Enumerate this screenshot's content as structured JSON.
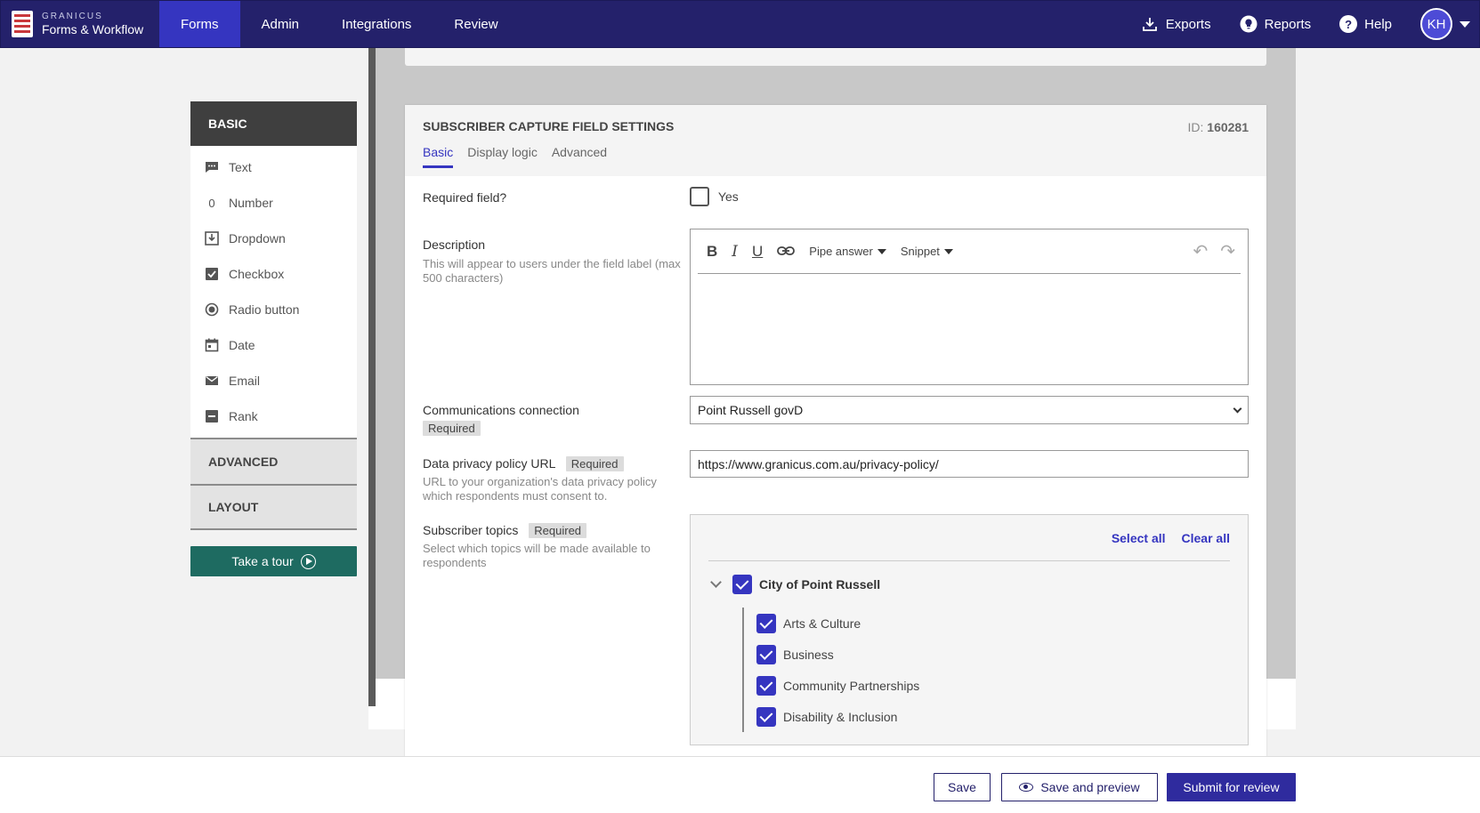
{
  "app": {
    "brand_top": "GRANICUS",
    "brand_bottom": "Forms & Workflow"
  },
  "nav": {
    "items": [
      {
        "label": "Forms"
      },
      {
        "label": "Admin"
      },
      {
        "label": "Integrations"
      },
      {
        "label": "Review"
      }
    ],
    "exports": "Exports",
    "reports": "Reports",
    "help": "Help",
    "avatar_initials": "KH"
  },
  "palette": {
    "basic_header": "BASIC",
    "items": [
      {
        "label": "Text",
        "icon": "text-field-icon"
      },
      {
        "label": "Number",
        "icon": "number-icon"
      },
      {
        "label": "Dropdown",
        "icon": "dropdown-icon"
      },
      {
        "label": "Checkbox",
        "icon": "checkbox-icon"
      },
      {
        "label": "Radio button",
        "icon": "radio-icon"
      },
      {
        "label": "Date",
        "icon": "calendar-icon"
      },
      {
        "label": "Email",
        "icon": "envelope-icon"
      },
      {
        "label": "Rank",
        "icon": "rank-icon"
      }
    ],
    "number_glyph": "0",
    "advanced": "ADVANCED",
    "layout": "LAYOUT",
    "tour": "Take a tour"
  },
  "settings": {
    "title": "SUBSCRIBER CAPTURE FIELD SETTINGS",
    "id_label": "ID:",
    "id_value": "160281",
    "tabs": [
      {
        "label": "Basic"
      },
      {
        "label": "Display logic"
      },
      {
        "label": "Advanced"
      }
    ],
    "required_field": {
      "label": "Required field?",
      "option": "Yes"
    },
    "description": {
      "label": "Description",
      "help": "This will appear to users under the field label (max 500 characters)",
      "pipe_answer": "Pipe answer",
      "snippet": "Snippet"
    },
    "communications": {
      "label": "Communications connection",
      "required": "Required",
      "value": "Point Russell govD"
    },
    "privacy": {
      "label": "Data privacy policy URL",
      "required": "Required",
      "help": "URL to your organization's data privacy policy which respondents must consent to.",
      "value": "https://www.granicus.com.au/privacy-policy/"
    },
    "topics": {
      "label": "Subscriber topics",
      "required": "Required",
      "help": "Select which topics will be made available to respondents",
      "select_all": "Select all",
      "clear_all": "Clear all",
      "root": "City of Point Russell",
      "children": [
        {
          "label": "Arts & Culture"
        },
        {
          "label": "Business"
        },
        {
          "label": "Community Partnerships"
        },
        {
          "label": "Disability & Inclusion"
        }
      ]
    }
  },
  "footer": {
    "save": "Save",
    "save_preview": "Save and preview",
    "submit": "Submit for review"
  }
}
